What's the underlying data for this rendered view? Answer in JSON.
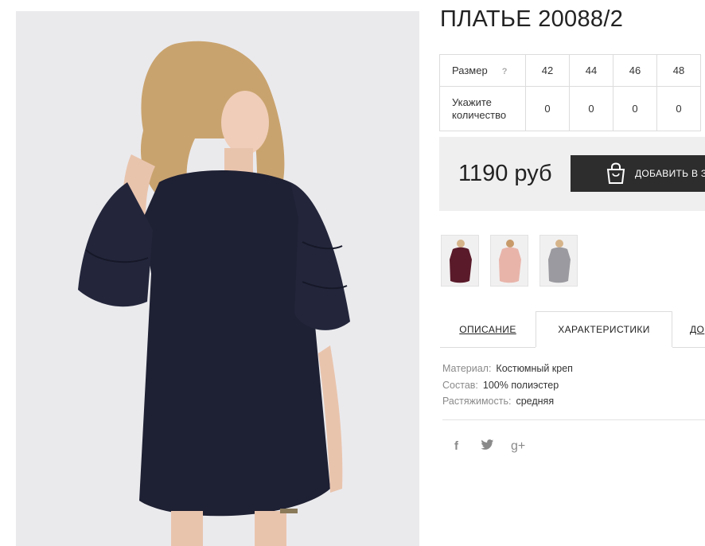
{
  "product": {
    "title": "ПЛАТЬЕ 20088/2",
    "photo_icon": "dress-photo"
  },
  "size_table": {
    "size_label": "Размер",
    "help_icon": "?",
    "quantity_label": "Укажите количество",
    "sizes": [
      "42",
      "44",
      "46",
      "48"
    ],
    "quantities": [
      "0",
      "0",
      "0",
      "0"
    ]
  },
  "price_block": {
    "price": "1190 руб",
    "cart_button_label": "ДОБАВИТЬ В З",
    "cart_icon": "shopping-bag-icon"
  },
  "color_variants": [
    {
      "name": "burgundy",
      "color": "#5a1a2a"
    },
    {
      "name": "pink",
      "color": "#e8b4aa"
    },
    {
      "name": "gray",
      "color": "#9a9aa0"
    }
  ],
  "tabs": [
    {
      "label": "ОПИСАНИЕ"
    },
    {
      "label": "ХАРАКТЕРИСТИКИ"
    },
    {
      "label": "ДО"
    }
  ],
  "specs": [
    {
      "key": "Материал:",
      "value": "Костюмный креп"
    },
    {
      "key": "Состав:",
      "value": "100% полиэстер"
    },
    {
      "key": "Растяжимость:",
      "value": "средняя"
    }
  ],
  "social": {
    "facebook": "f",
    "google_plus": "g+"
  },
  "colors": {
    "dress": "#1e2033",
    "button": "#2d2d2d",
    "price_bg": "#efefef"
  }
}
